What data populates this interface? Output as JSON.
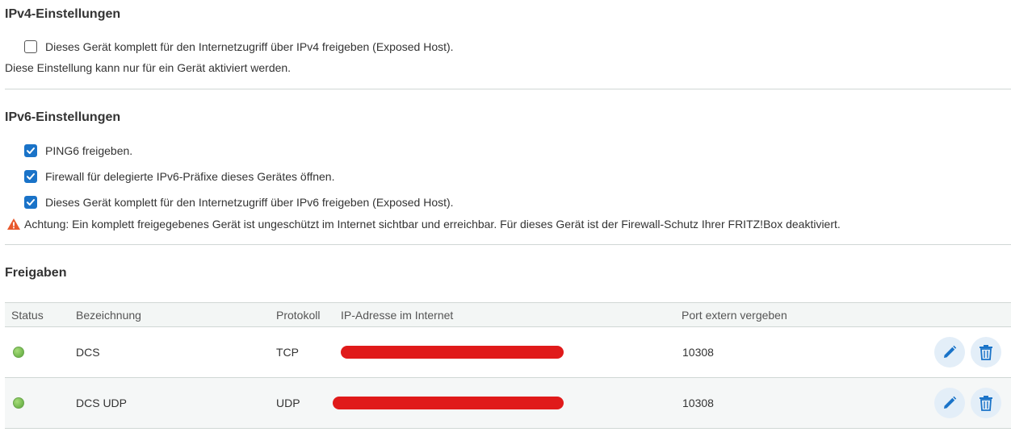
{
  "ipv4": {
    "heading": "IPv4-Einstellungen",
    "exposed_host_label": "Dieses Gerät komplett für den Internetzugriff über IPv4 freigeben (Exposed Host).",
    "exposed_host_checked": false,
    "note": "Diese Einstellung kann nur für ein Gerät aktiviert werden."
  },
  "ipv6": {
    "heading": "IPv6-Einstellungen",
    "options": [
      {
        "label": "PING6 freigeben.",
        "checked": true
      },
      {
        "label": "Firewall für delegierte IPv6-Präfixe dieses Gerätes öffnen.",
        "checked": true
      },
      {
        "label": "Dieses Gerät komplett für den Internetzugriff über IPv6 freigeben (Exposed Host).",
        "checked": true
      }
    ],
    "warning": "Achtung: Ein komplett freigegebenes Gerät ist ungeschützt im Internet sichtbar und erreichbar. Für dieses Gerät ist der Firewall-Schutz Ihrer FRITZ!Box deaktiviert."
  },
  "freigaben": {
    "heading": "Freigaben",
    "columns": [
      "Status",
      "Bezeichnung",
      "Protokoll",
      "IP-Adresse im Internet",
      "Port extern vergeben"
    ],
    "rows": [
      {
        "status": "active",
        "name": "DCS",
        "protocol": "TCP",
        "ip": "",
        "port": "10308"
      },
      {
        "status": "active",
        "name": "DCS UDP",
        "protocol": "UDP",
        "ip": "",
        "port": "10308"
      }
    ]
  },
  "icons": {
    "checkbox": "checkmark-icon",
    "warning": "warning-triangle-icon",
    "edit": "pencil-icon",
    "delete": "trash-icon"
  },
  "colors": {
    "accent": "#1a73c8",
    "status_active": "#5aa53a",
    "warning": "#e8582c",
    "redaction": "#e01a1a"
  }
}
